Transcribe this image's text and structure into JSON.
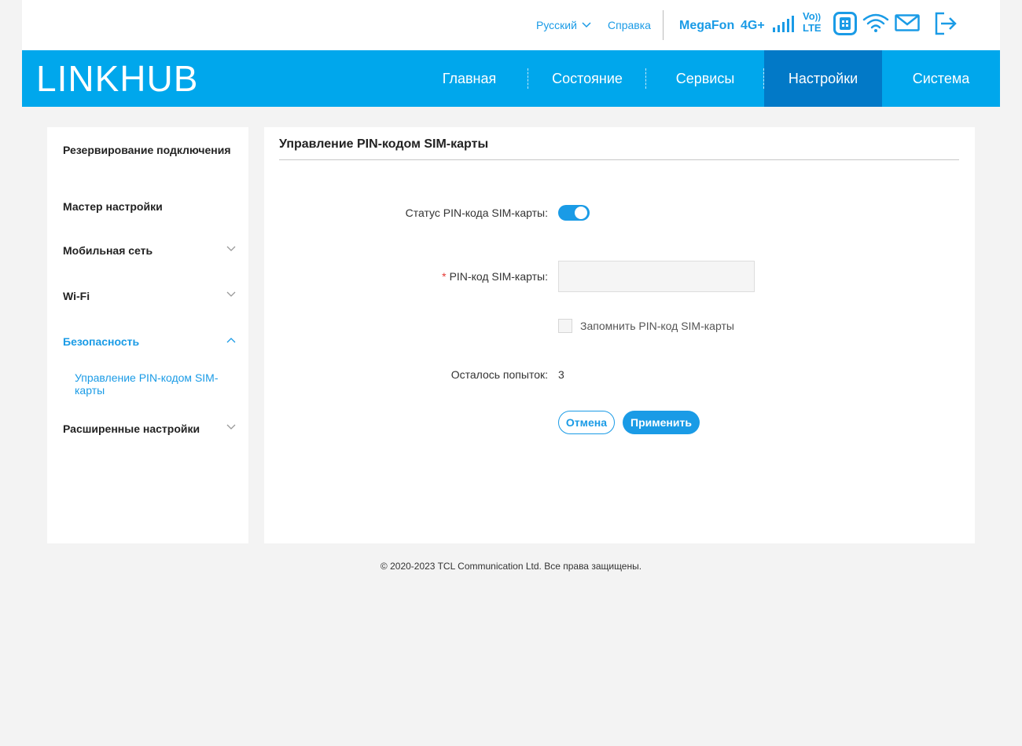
{
  "topbar": {
    "language": "Русский",
    "help": "Справка",
    "operator": "MegaFon",
    "network": "4G+",
    "volte": "Vo",
    "volte_lte": "LTE"
  },
  "brand": {
    "logo_part1": "LINK",
    "logo_part2": "HUB",
    "accent_color": "#00a7ec",
    "active_tab_color": "#0279c7"
  },
  "nav": {
    "items": [
      "Главная",
      "Состояние",
      "Сервисы",
      "Настройки",
      "Система"
    ],
    "active": "Настройки"
  },
  "sidebar": {
    "items": [
      "Резервирование подключения",
      "Мастер настройки",
      "Мобильная сеть",
      "Wi-Fi",
      "Безопасность",
      "Расширенные настройки"
    ],
    "active": "Безопасность",
    "subitem": "Управление PIN-кодом SIM-карты"
  },
  "main": {
    "title": "Управление PIN-кодом SIM-карты",
    "status_label": "Статус PIN-кода SIM-карты:",
    "status_enabled": true,
    "pin_required_mark": "*",
    "pin_label": "PIN-код SIM-карты:",
    "pin_value": "",
    "remember_label": "Запомнить PIN-код SIM-карты",
    "remember_checked": false,
    "attempts_label": "Осталось попыток:",
    "attempts_value": "3",
    "cancel_label": "Отмена",
    "apply_label": "Применить"
  },
  "footer": {
    "copyright": "© 2020-2023 TCL Communication Ltd. Все права защищены."
  },
  "icons": [
    "chevron-down-icon",
    "signal-icon",
    "volte-icon",
    "sim-icon",
    "wifi-icon",
    "mail-icon",
    "logout-icon",
    "chevron-up-icon"
  ]
}
